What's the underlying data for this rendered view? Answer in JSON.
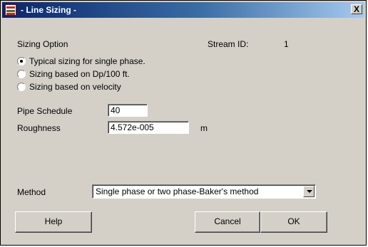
{
  "window": {
    "title": "- Line Sizing -",
    "close_label": "X"
  },
  "sizing": {
    "heading": "Sizing Option",
    "options": [
      {
        "label": "Typical sizing for single phase.",
        "checked": true
      },
      {
        "label": "Sizing based on Dp/100 ft.",
        "checked": false
      },
      {
        "label": "Sizing based on velocity",
        "checked": false
      }
    ]
  },
  "stream": {
    "label": "Stream ID:",
    "value": "1"
  },
  "pipe_schedule": {
    "label": "Pipe Schedule",
    "value": "40"
  },
  "roughness": {
    "label": "Roughness",
    "value": "4.572e-005",
    "unit": "m"
  },
  "method": {
    "label": "Method",
    "value": "Single phase or two phase-Baker's method"
  },
  "buttons": {
    "help": "Help",
    "cancel": "Cancel",
    "ok": "OK"
  }
}
